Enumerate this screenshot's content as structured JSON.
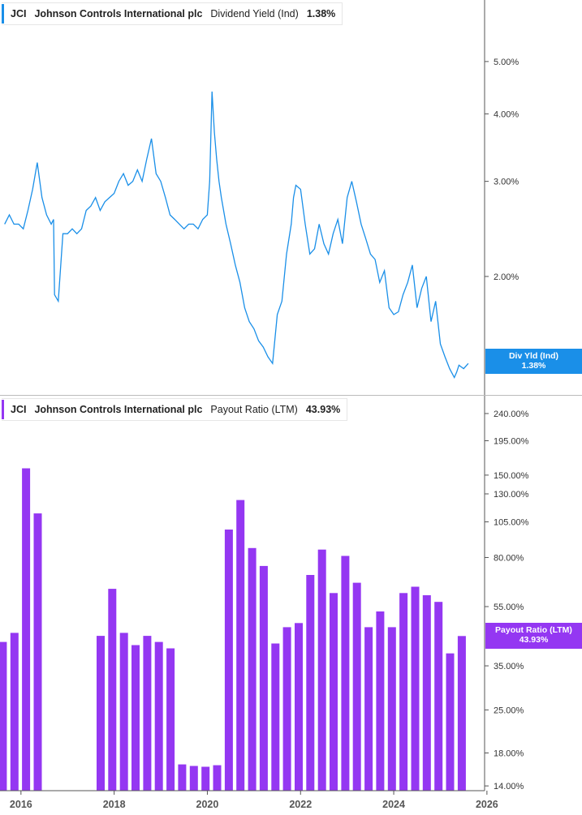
{
  "chart_data": [
    {
      "type": "line",
      "ticker": "JCI",
      "company": "Johnson Controls International plc",
      "metric": "Dividend Yield (Ind)",
      "current_value": "1.38%",
      "badge": {
        "label": "Div Yld (Ind)",
        "value": "1.38%"
      },
      "color": "#1a8fe8",
      "y_scale": "log",
      "ylim": [
        1.28,
        5.9
      ],
      "y_ticks": [
        "5.00%",
        "4.00%",
        "3.00%",
        "2.00%"
      ],
      "y_tick_values": [
        5.0,
        4.0,
        3.0,
        2.0
      ],
      "x": [
        2015.65,
        2015.75,
        2015.85,
        2015.95,
        2016.05,
        2016.15,
        2016.25,
        2016.35,
        2016.45,
        2016.55,
        2016.65,
        2016.7,
        2016.72,
        2016.8,
        2016.9,
        2017.0,
        2017.1,
        2017.2,
        2017.3,
        2017.4,
        2017.5,
        2017.6,
        2017.7,
        2017.8,
        2017.9,
        2018.0,
        2018.1,
        2018.2,
        2018.3,
        2018.4,
        2018.5,
        2018.6,
        2018.7,
        2018.8,
        2018.9,
        2019.0,
        2019.1,
        2019.2,
        2019.3,
        2019.4,
        2019.5,
        2019.6,
        2019.7,
        2019.8,
        2019.9,
        2020.0,
        2020.05,
        2020.1,
        2020.15,
        2020.2,
        2020.25,
        2020.3,
        2020.4,
        2020.5,
        2020.6,
        2020.7,
        2020.8,
        2020.9,
        2021.0,
        2021.1,
        2021.2,
        2021.3,
        2021.4,
        2021.5,
        2021.6,
        2021.7,
        2021.8,
        2021.85,
        2021.9,
        2022.0,
        2022.1,
        2022.2,
        2022.3,
        2022.4,
        2022.5,
        2022.6,
        2022.7,
        2022.8,
        2022.9,
        2023.0,
        2023.1,
        2023.2,
        2023.3,
        2023.4,
        2023.5,
        2023.6,
        2023.7,
        2023.8,
        2023.9,
        2024.0,
        2024.1,
        2024.2,
        2024.3,
        2024.4,
        2024.5,
        2024.6,
        2024.7,
        2024.8,
        2024.9,
        2025.0,
        2025.1,
        2025.2,
        2025.3,
        2025.35,
        2025.4,
        2025.5,
        2025.6,
        2025.7
      ],
      "y": [
        2.5,
        2.6,
        2.5,
        2.5,
        2.45,
        2.65,
        2.9,
        3.25,
        2.8,
        2.6,
        2.5,
        2.55,
        1.85,
        1.8,
        2.4,
        2.4,
        2.45,
        2.4,
        2.45,
        2.65,
        2.7,
        2.8,
        2.65,
        2.75,
        2.8,
        2.85,
        3.0,
        3.1,
        2.95,
        3.0,
        3.15,
        3.0,
        3.3,
        3.6,
        3.1,
        3.0,
        2.8,
        2.6,
        2.55,
        2.5,
        2.45,
        2.5,
        2.5,
        2.45,
        2.55,
        2.6,
        3.0,
        4.4,
        3.7,
        3.3,
        3.0,
        2.8,
        2.5,
        2.3,
        2.1,
        1.95,
        1.75,
        1.65,
        1.6,
        1.52,
        1.48,
        1.42,
        1.38,
        1.7,
        1.8,
        2.2,
        2.5,
        2.8,
        2.95,
        2.9,
        2.5,
        2.2,
        2.25,
        2.5,
        2.3,
        2.2,
        2.4,
        2.55,
        2.3,
        2.8,
        3.0,
        2.75,
        2.5,
        2.35,
        2.2,
        2.15,
        1.95,
        2.05,
        1.75,
        1.7,
        1.72,
        1.85,
        1.95,
        2.1,
        1.75,
        1.9,
        2.0,
        1.65,
        1.8,
        1.5,
        1.42,
        1.35,
        1.3,
        1.33,
        1.37,
        1.35,
        1.38
      ]
    },
    {
      "type": "bar",
      "ticker": "JCI",
      "company": "Johnson Controls International plc",
      "metric": "Payout Ratio (LTM)",
      "current_value": "43.93%",
      "badge": {
        "label": "Payout Ratio (LTM)",
        "value": "43.93%"
      },
      "color": "#9437f2",
      "y_scale": "log",
      "ylim": [
        13.5,
        260
      ],
      "y_ticks": [
        "240.00%",
        "195.00%",
        "150.00%",
        "130.00%",
        "105.00%",
        "80.00%",
        "55.00%",
        "35.00%",
        "25.00%",
        "18.00%",
        "14.00%"
      ],
      "y_tick_values": [
        240,
        195,
        150,
        130,
        105,
        80,
        55,
        35,
        25,
        18,
        14
      ],
      "x": [
        2015.61,
        2015.86,
        2016.11,
        2016.36,
        2017.71,
        2017.96,
        2018.21,
        2018.46,
        2018.71,
        2018.96,
        2019.21,
        2019.46,
        2019.71,
        2019.96,
        2020.21,
        2020.46,
        2020.71,
        2020.96,
        2021.21,
        2021.46,
        2021.71,
        2021.96,
        2022.21,
        2022.46,
        2022.71,
        2022.96,
        2023.21,
        2023.46,
        2023.71,
        2023.96,
        2024.21,
        2024.46,
        2024.71,
        2024.96,
        2025.21,
        2025.46
      ],
      "values": [
        42,
        45,
        158,
        112,
        44,
        63,
        45,
        41,
        44,
        42,
        40,
        16.5,
        16.3,
        16.2,
        16.4,
        99,
        124,
        86,
        75,
        41.5,
        47,
        48.5,
        70,
        85,
        61,
        81,
        66,
        47,
        53,
        47,
        61,
        64,
        60,
        57,
        38.5,
        43.93
      ]
    }
  ],
  "x_axis": {
    "ticks": [
      "2016",
      "2018",
      "2020",
      "2022",
      "2024",
      "2026"
    ],
    "tick_values": [
      2016,
      2018,
      2020,
      2022,
      2024,
      2026
    ],
    "xlim": [
      2015.55,
      2025.95
    ]
  }
}
